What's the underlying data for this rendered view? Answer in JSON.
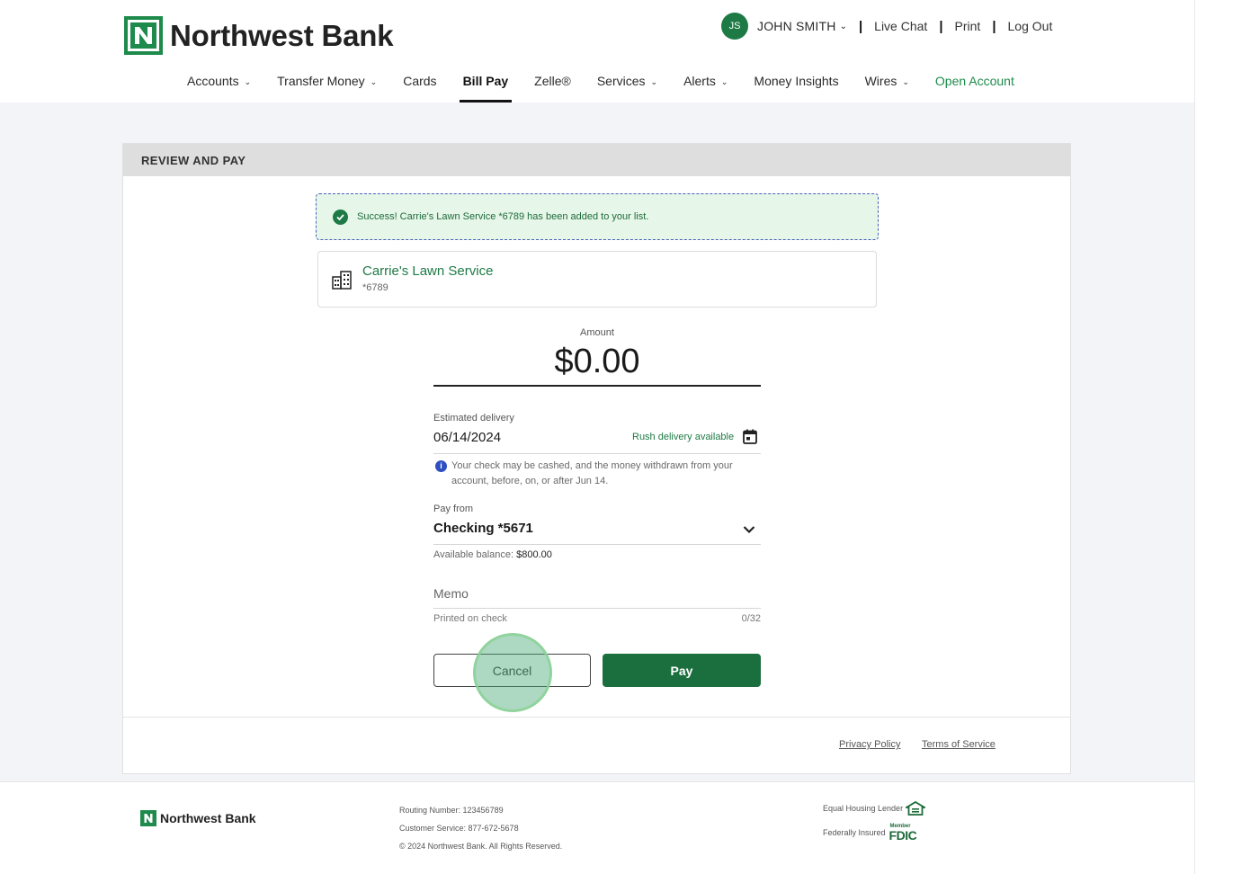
{
  "header": {
    "bank_name": "Northwest Bank",
    "user_initials": "JS",
    "user_name": "JOHN SMITH",
    "links": {
      "live_chat": "Live Chat",
      "print": "Print",
      "log_out": "Log Out"
    }
  },
  "nav": {
    "items": [
      {
        "label": "Accounts"
      },
      {
        "label": "Transfer Money"
      },
      {
        "label": "Cards"
      },
      {
        "label": "Bill Pay"
      },
      {
        "label": "Zelle®"
      },
      {
        "label": "Services"
      },
      {
        "label": "Alerts"
      },
      {
        "label": "Money Insights"
      },
      {
        "label": "Wires"
      },
      {
        "label": "Open Account"
      }
    ]
  },
  "card": {
    "title": "REVIEW AND PAY",
    "success_message": "Success! Carrie's Lawn Service *6789 has been added to your list.",
    "payee": {
      "name": "Carrie's Lawn Service",
      "account": "*6789"
    },
    "amount": {
      "label": "Amount",
      "value": "$0.00"
    },
    "delivery": {
      "label": "Estimated delivery",
      "date": "06/14/2024",
      "rush": "Rush delivery available",
      "info": "Your check may be cashed, and the money withdrawn from your account, before, on, or after Jun 14."
    },
    "pay_from": {
      "label": "Pay from",
      "value": "Checking *5671",
      "available_label": "Available balance:",
      "available_value": "$800.00"
    },
    "memo": {
      "label": "Memo",
      "helper": "Printed on check",
      "count": "0/32"
    },
    "buttons": {
      "cancel": "Cancel",
      "pay": "Pay"
    },
    "footer_links": {
      "privacy": "Privacy Policy",
      "terms": "Terms of Service"
    }
  },
  "footer": {
    "bank_name": "Northwest Bank",
    "routing": "Routing Number: 123456789",
    "customer_service": "Customer Service: 877-672-5678",
    "copyright": "© 2024 Northwest Bank. All Rights Reserved.",
    "equal_housing": "Equal Housing Lender",
    "federally_insured": "Federally Insured",
    "fdic_member": "Member",
    "fdic": "FDIC"
  },
  "colors": {
    "brand_green": "#1e8a4c",
    "pay_button": "#1b6e3d",
    "success_bg": "#e6f6e9",
    "info_blue": "#2e4fbf"
  }
}
